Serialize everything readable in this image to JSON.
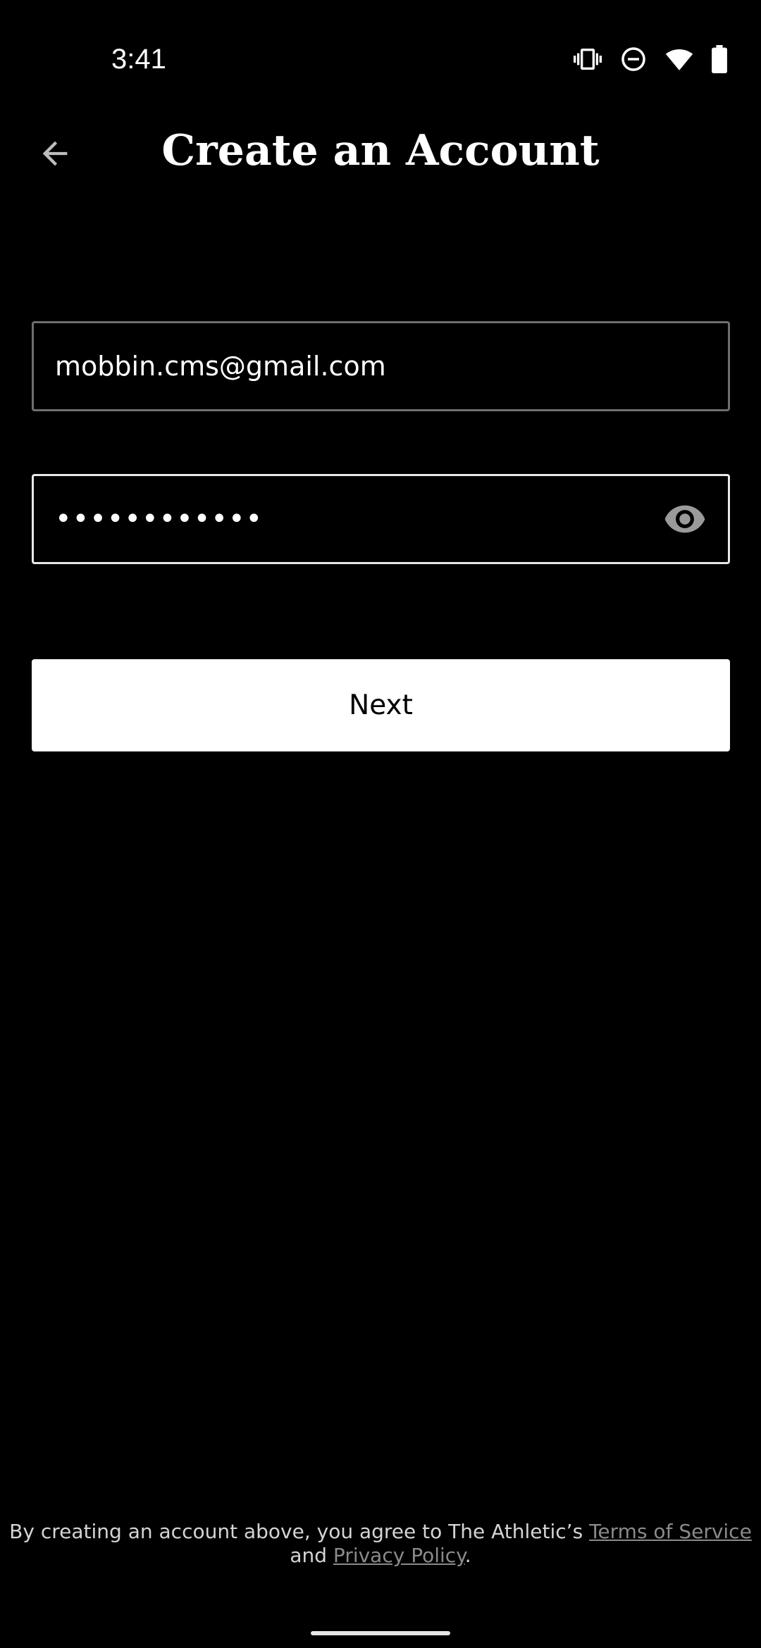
{
  "status_bar": {
    "time": "3:41",
    "icons": [
      "vibrate-icon",
      "do-not-disturb-icon",
      "wifi-icon",
      "battery-icon"
    ]
  },
  "header": {
    "title": "Create an Account",
    "back_icon": "arrow-left-icon"
  },
  "form": {
    "email_value": "mobbin.cms@gmail.com",
    "password_value": "••••••••••••",
    "password_toggle_icon": "eye-icon",
    "next_label": "Next"
  },
  "legal": {
    "prefix": "By creating an account above, you agree to The Athletic’s ",
    "terms_label": "Terms of Service",
    "and_text": "and ",
    "privacy_label": "Privacy Policy",
    "suffix": "."
  },
  "colors": {
    "background": "#000000",
    "text": "#ffffff",
    "button_bg": "#ffffff",
    "button_text": "#000000",
    "link": "#8a8a8a",
    "email_border": "#6e6e6e",
    "password_border": "#e8e8e8"
  }
}
